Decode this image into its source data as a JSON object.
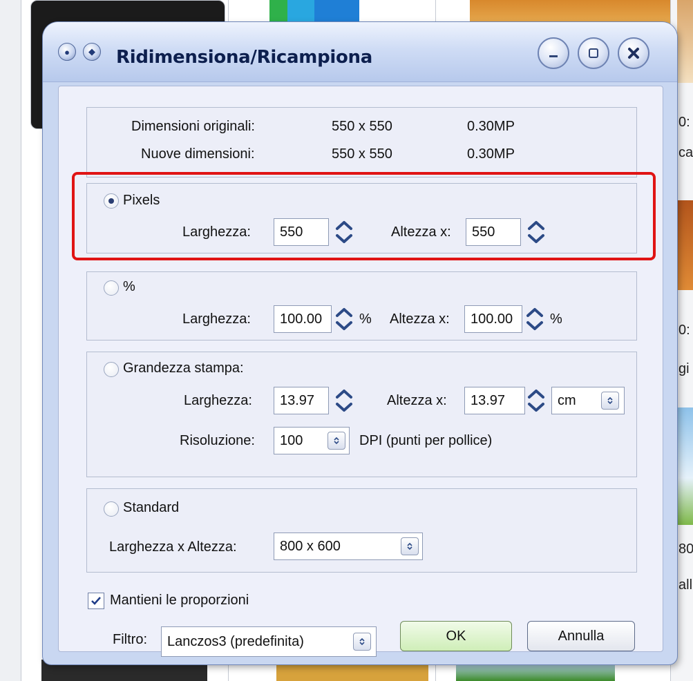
{
  "background": {
    "side_texts": [
      "0:",
      "ca",
      "0:",
      "gi",
      "80",
      "allp"
    ]
  },
  "dialog": {
    "title": "Ridimensiona/Ricampiona",
    "info": {
      "original_label": "Dimensioni originali:",
      "original_size": "550 x 550",
      "original_mp": "0.30MP",
      "new_label": "Nuove dimensioni:",
      "new_size": "550 x 550",
      "new_mp": "0.30MP"
    },
    "pixels": {
      "radio_label": "Pixels",
      "selected": true,
      "width_label": "Larghezza:",
      "width_value": "550",
      "height_label": "Altezza x:",
      "height_value": "550"
    },
    "percent": {
      "radio_label": "%",
      "width_label": "Larghezza:",
      "width_value": "100.00",
      "width_unit": "%",
      "height_label": "Altezza x:",
      "height_value": "100.00",
      "height_unit": "%"
    },
    "print_size": {
      "radio_label": "Grandezza stampa:",
      "width_label": "Larghezza:",
      "width_value": "13.97",
      "height_label": "Altezza x:",
      "height_value": "13.97",
      "unit_selected": "cm",
      "resolution_label": "Risoluzione:",
      "resolution_value": "100",
      "resolution_unit": "DPI (punti per pollice)"
    },
    "standard": {
      "radio_label": "Standard",
      "size_label": "Larghezza x Altezza:",
      "size_selected": "800 x 600"
    },
    "keep_proportions": {
      "label": "Mantieni le proporzioni",
      "checked": true
    },
    "filter": {
      "label": "Filtro:",
      "selected": "Lanczos3 (predefinita)"
    },
    "buttons": {
      "ok": "OK",
      "cancel": "Annulla"
    }
  },
  "colors": {
    "highlight": "#e01414",
    "ok_button": "#cfeeb8"
  }
}
